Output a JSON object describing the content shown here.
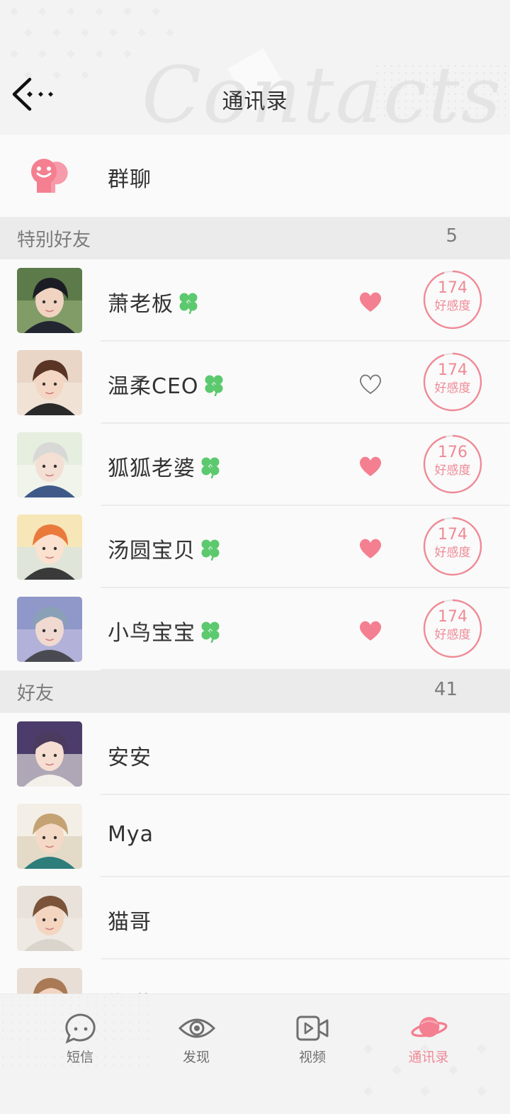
{
  "header": {
    "title": "通讯录",
    "watermark": "Contacts"
  },
  "group_chat": {
    "label": "群聊"
  },
  "special_section": {
    "label": "特别好友",
    "count": "5",
    "contacts": [
      {
        "name": "萧老板",
        "liked": true,
        "affinity": "174",
        "affinity_fraction": 0.95,
        "affinity_label": "好感度"
      },
      {
        "name": "温柔CEO",
        "liked": false,
        "affinity": "174",
        "affinity_fraction": 0.95,
        "affinity_label": "好感度"
      },
      {
        "name": "狐狐老婆",
        "liked": true,
        "affinity": "176",
        "affinity_fraction": 0.96,
        "affinity_label": "好感度"
      },
      {
        "name": "汤圆宝贝",
        "liked": true,
        "affinity": "174",
        "affinity_fraction": 0.95,
        "affinity_label": "好感度"
      },
      {
        "name": "小鸟宝宝",
        "liked": true,
        "affinity": "174",
        "affinity_fraction": 0.95,
        "affinity_label": "好感度"
      }
    ]
  },
  "friends_section": {
    "label": "好友",
    "count": "41",
    "contacts": [
      {
        "name": "安安"
      },
      {
        "name": "Mya"
      },
      {
        "name": "猫哥"
      },
      {
        "name": "郑琳"
      }
    ]
  },
  "tabbar": {
    "tabs": [
      {
        "label": "短信",
        "icon": "chat-bubble-icon",
        "active": false
      },
      {
        "label": "发现",
        "icon": "eye-icon",
        "active": false
      },
      {
        "label": "视频",
        "icon": "video-camera-icon",
        "active": false
      },
      {
        "label": "通讯录",
        "icon": "planet-icon",
        "active": true
      }
    ]
  },
  "colors": {
    "accent_pink": "#ef8a96",
    "heart_pink": "#f47f90",
    "clover_green": "#5cc96e",
    "section_bg": "#ebebeb"
  }
}
